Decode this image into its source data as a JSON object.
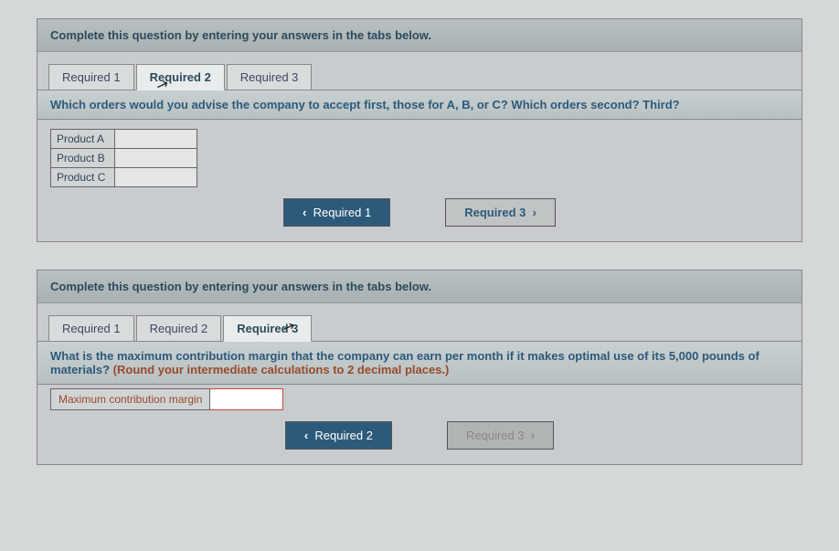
{
  "block1": {
    "instruction": "Complete this question by entering your answers in the tabs below.",
    "tabs": [
      "Required 1",
      "Required 2",
      "Required 3"
    ],
    "active_tab_index": 1,
    "question": "Which orders would you advise the company to accept first, those for A, B, or C? Which orders second? Third?",
    "rows": [
      "Product A",
      "Product B",
      "Product C"
    ],
    "nav_prev": "Required 1",
    "nav_next": "Required 3"
  },
  "block2": {
    "instruction": "Complete this question by entering your answers in the tabs below.",
    "tabs": [
      "Required 1",
      "Required 2",
      "Required 3"
    ],
    "active_tab_index": 2,
    "question_main": "What is the maximum contribution margin that the company can earn per month if it makes optimal use of its 5,000 pounds of materials? ",
    "question_hint": "(Round your intermediate calculations to 2 decimal places.)",
    "row_label": "Maximum contribution margin",
    "nav_prev": "Required 2",
    "nav_next": "Required 3"
  },
  "glyphs": {
    "chev_left": "‹",
    "chev_right": "›",
    "cursor": "↖"
  }
}
